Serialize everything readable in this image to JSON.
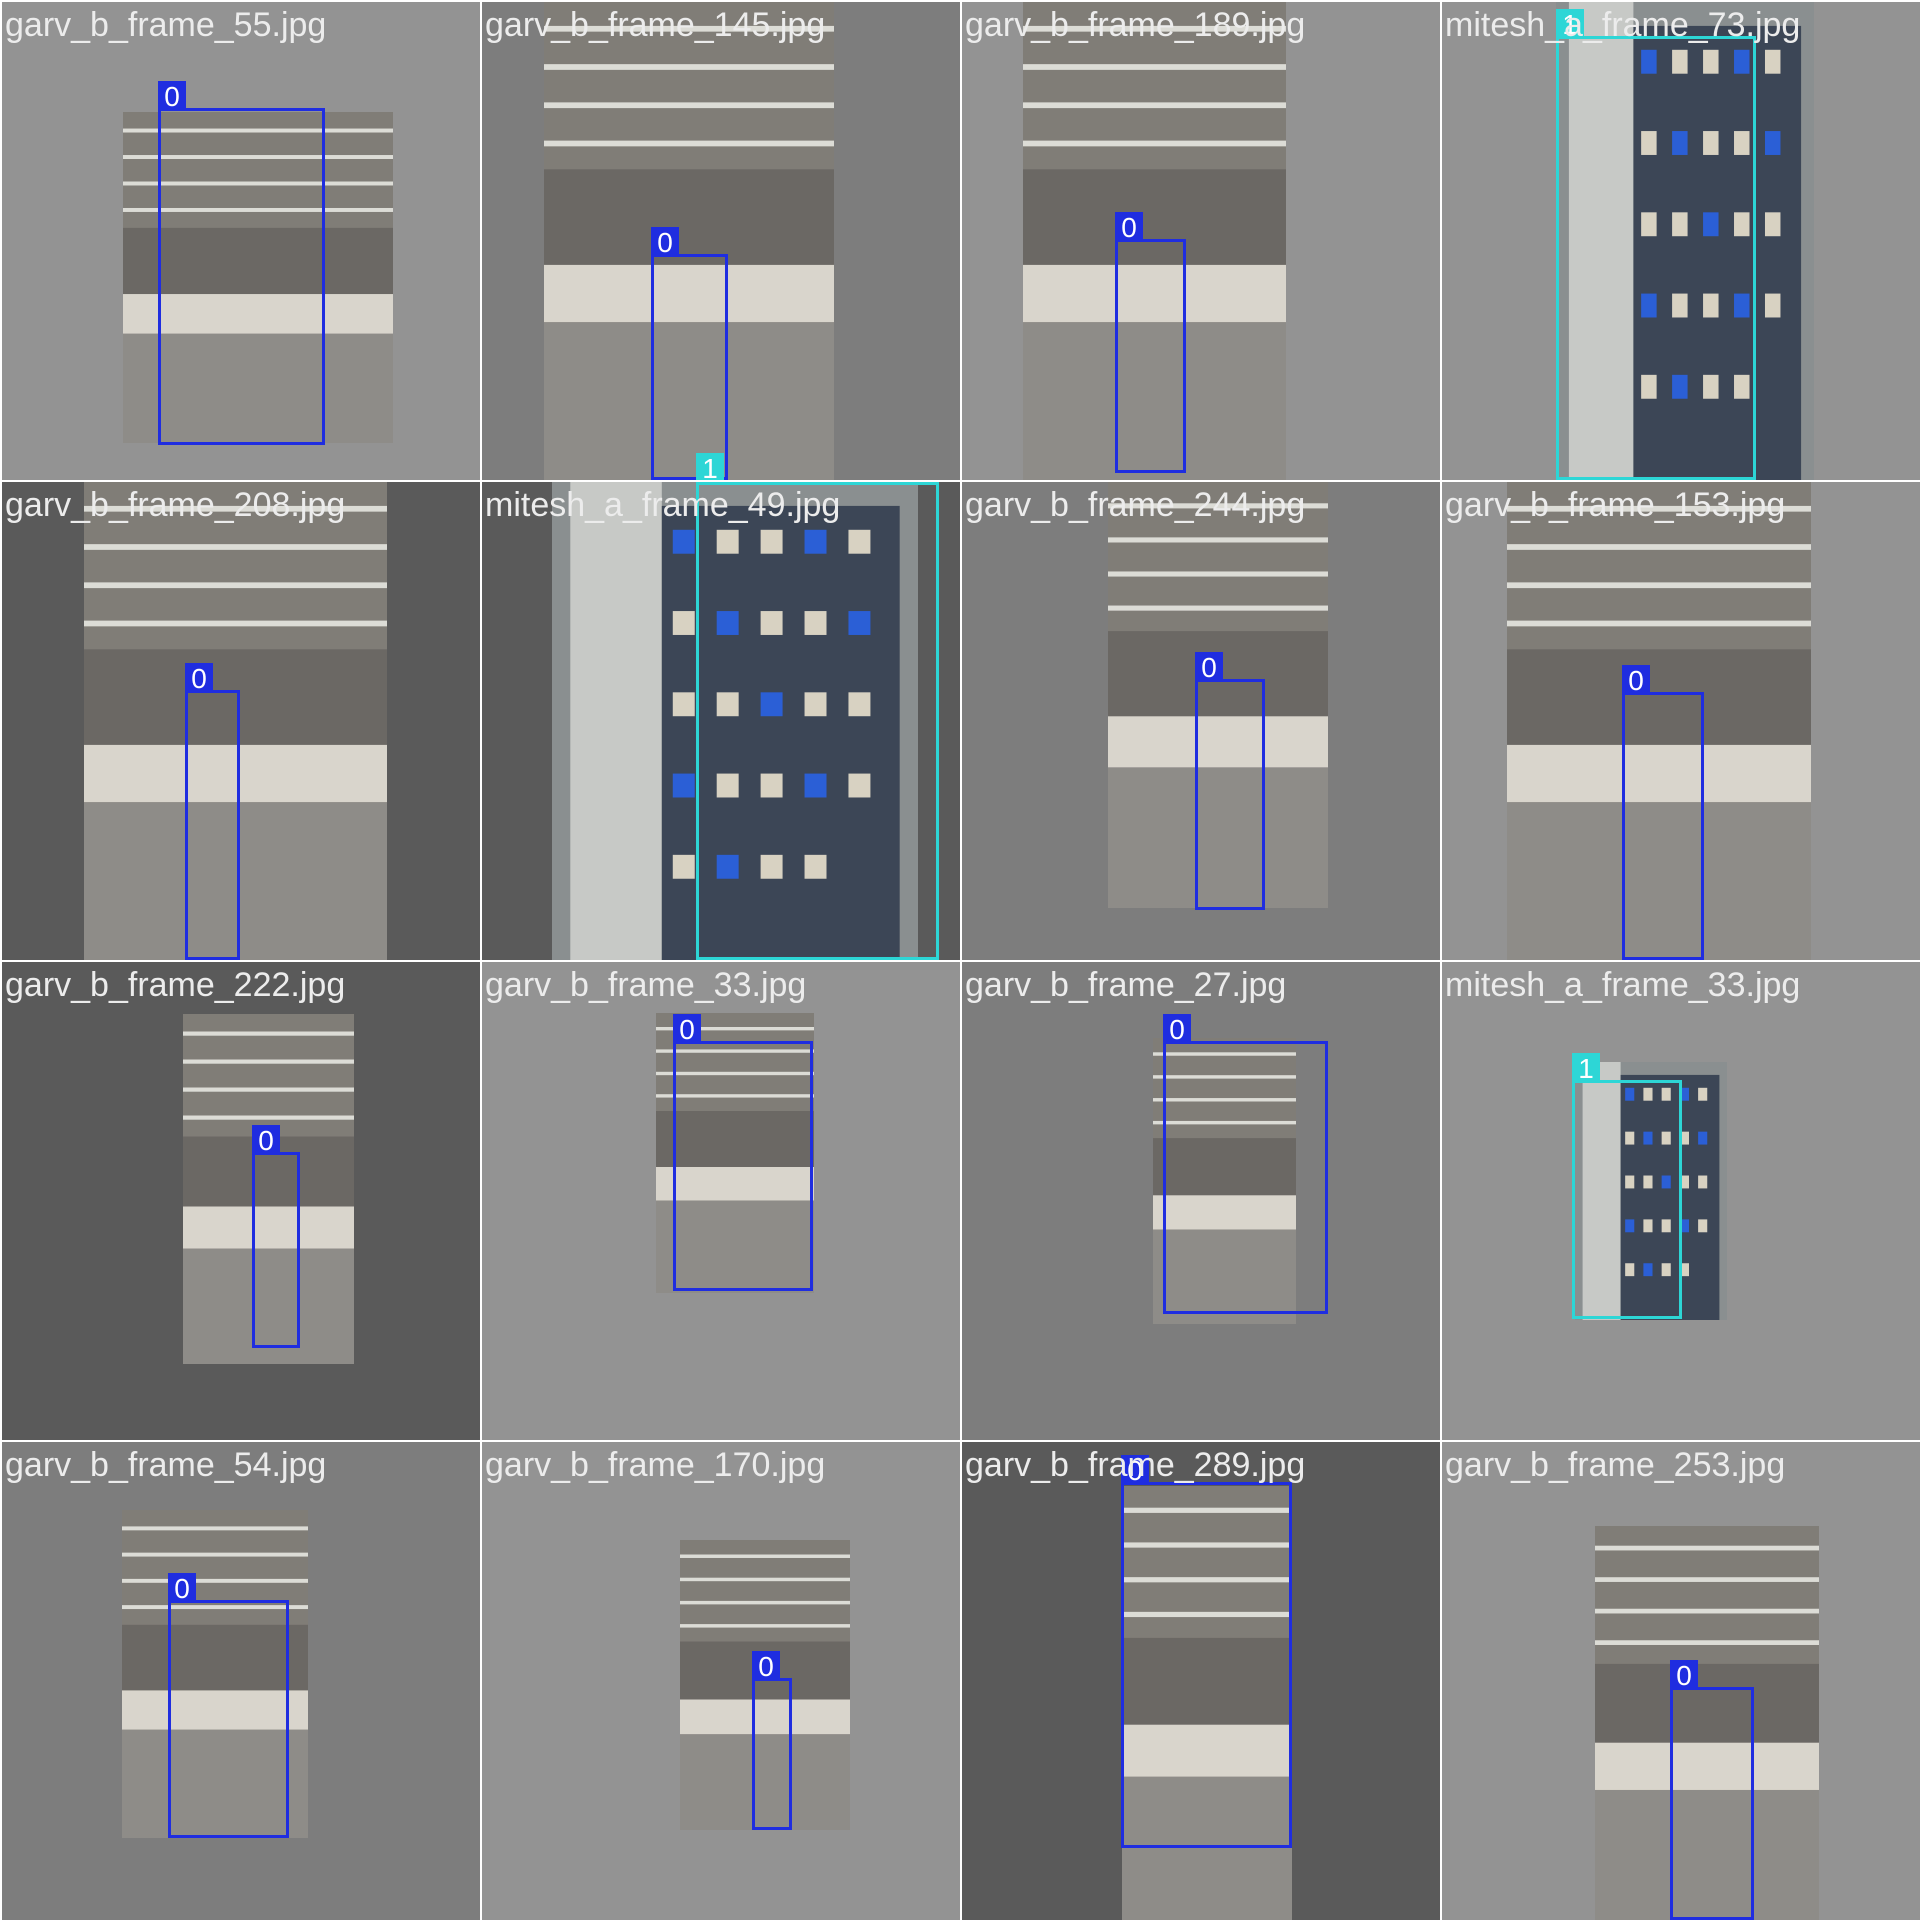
{
  "colors": {
    "class_0": "#1f2de0",
    "class_1": "#2dd6d6",
    "label_text": "#ececec"
  },
  "tiles": [
    {
      "filename": "garv_b_frame_55.jpg",
      "boxes": [
        {
          "class": "0"
        }
      ]
    },
    {
      "filename": "garv_b_frame_145.jpg",
      "boxes": [
        {
          "class": "0"
        },
        {
          "class": "1"
        }
      ]
    },
    {
      "filename": "garv_b_frame_189.jpg",
      "boxes": [
        {
          "class": "0"
        }
      ]
    },
    {
      "filename": "mitesh_a_frame_73.jpg",
      "boxes": [
        {
          "class": "1"
        }
      ]
    },
    {
      "filename": "garv_b_frame_208.jpg",
      "boxes": [
        {
          "class": "0"
        }
      ]
    },
    {
      "filename": "mitesh_a_frame_49.jpg",
      "boxes": []
    },
    {
      "filename": "garv_b_frame_244.jpg",
      "boxes": [
        {
          "class": "0"
        }
      ]
    },
    {
      "filename": "garv_b_frame_153.jpg",
      "boxes": [
        {
          "class": "0"
        }
      ]
    },
    {
      "filename": "garv_b_frame_222.jpg",
      "boxes": [
        {
          "class": "0"
        }
      ]
    },
    {
      "filename": "garv_b_frame_33.jpg",
      "boxes": [
        {
          "class": "0"
        }
      ]
    },
    {
      "filename": "garv_b_frame_27.jpg",
      "boxes": [
        {
          "class": "0"
        }
      ]
    },
    {
      "filename": "mitesh_a_frame_33.jpg",
      "boxes": [
        {
          "class": "1"
        }
      ]
    },
    {
      "filename": "garv_b_frame_54.jpg",
      "boxes": [
        {
          "class": "0"
        }
      ]
    },
    {
      "filename": "garv_b_frame_170.jpg",
      "boxes": [
        {
          "class": "0"
        }
      ]
    },
    {
      "filename": "garv_b_frame_289.jpg",
      "boxes": [
        {
          "class": "0"
        }
      ]
    },
    {
      "filename": "garv_b_frame_253.jpg",
      "boxes": [
        {
          "class": "0"
        }
      ]
    }
  ]
}
